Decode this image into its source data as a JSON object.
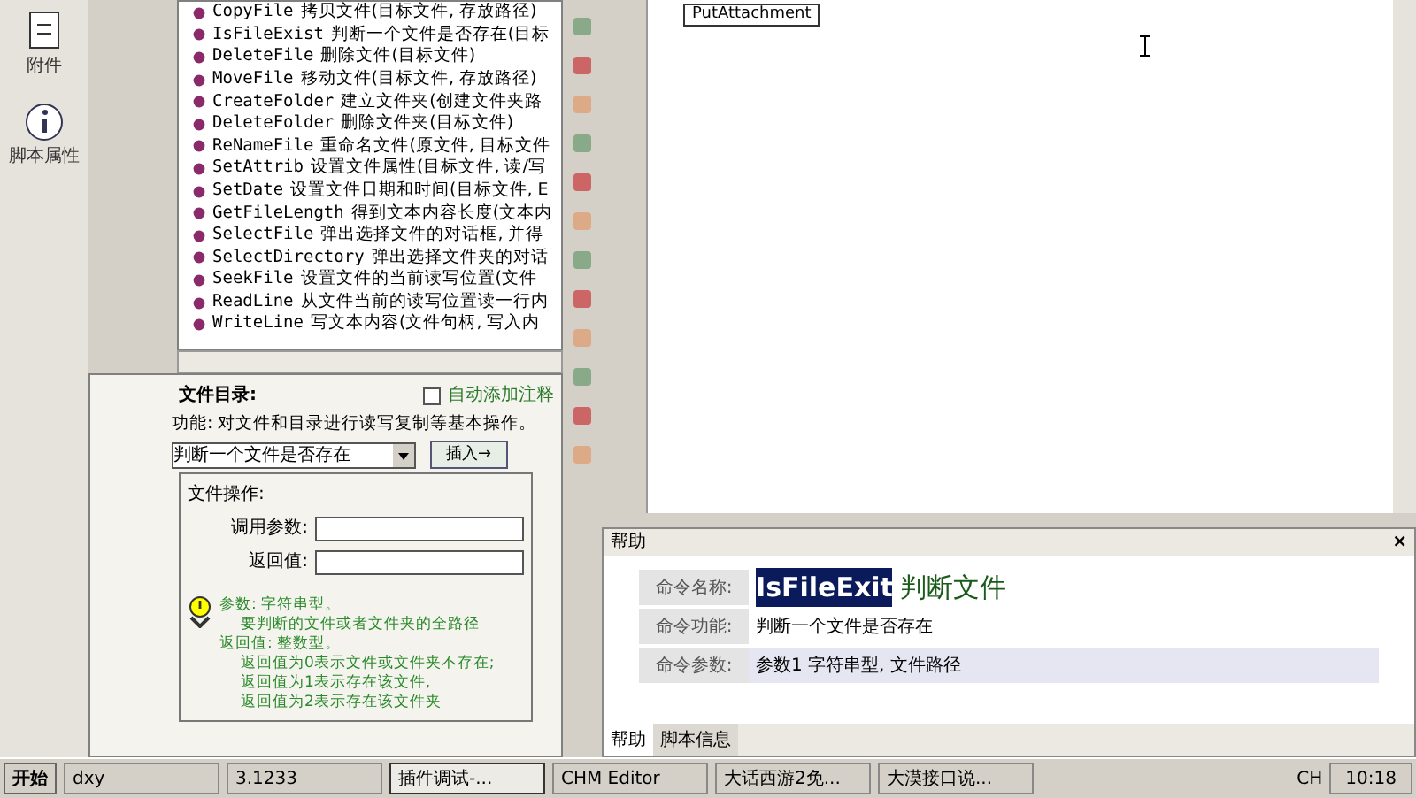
{
  "sidebar": {
    "items": [
      {
        "label": "附件",
        "kind": "attach"
      },
      {
        "label": "脚本属性",
        "kind": "info"
      }
    ]
  },
  "tree": {
    "items": [
      {
        "name": "CopyFile",
        "desc": "拷贝文件(目标文件, 存放路径)"
      },
      {
        "name": "IsFileExist",
        "desc": "判断一个文件是否存在(目标"
      },
      {
        "name": "DeleteFile",
        "desc": "删除文件(目标文件)"
      },
      {
        "name": "MoveFile",
        "desc": "移动文件(目标文件, 存放路径)"
      },
      {
        "name": "CreateFolder",
        "desc": "建立文件夹(创建文件夹路"
      },
      {
        "name": "DeleteFolder",
        "desc": "删除文件夹(目标文件)"
      },
      {
        "name": "ReNameFile",
        "desc": "重命名文件(原文件, 目标文件"
      },
      {
        "name": "SetAttrib",
        "desc": "设置文件属性(目标文件, 读/写"
      },
      {
        "name": "SetDate",
        "desc": "设置文件日期和时间(目标文件, E"
      },
      {
        "name": "GetFileLength",
        "desc": "得到文本内容长度(文本内"
      },
      {
        "name": "SelectFile",
        "desc": "弹出选择文件的对话框, 并得"
      },
      {
        "name": "SelectDirectory",
        "desc": "弹出选择文件夹的对话"
      },
      {
        "name": "SeekFile",
        "desc": "设置文件的当前读写位置(文件"
      },
      {
        "name": "ReadLine",
        "desc": "从文件当前的读写位置读一行内"
      },
      {
        "name": "WriteLine",
        "desc": "写文本内容(文件句柄, 写入内"
      }
    ]
  },
  "command_panel": {
    "category_label": "文件目录:",
    "auto_comment": {
      "label": "自动添加注释",
      "checked": false
    },
    "function_text": "功能: 对文件和目录进行读写复制等基本操作。",
    "command_select": "判断一个文件是否存在",
    "insert_button": "插入→",
    "group_title": "文件操作:",
    "fields": [
      {
        "label": "调用参数:"
      },
      {
        "label": "返回值:"
      }
    ],
    "hint_lines": [
      "参数: 字符串型。",
      "要判断的文件或者文件夹的全路径",
      "返回值: 整数型。",
      "返回值为0表示文件或文件夹不存在;",
      "返回值为1表示存在该文件,",
      "返回值为2表示存在该文件夹"
    ]
  },
  "editor": {
    "button": "PutAttachment"
  },
  "help": {
    "title": "帮助",
    "close": "×",
    "rows": [
      {
        "label": "命令名称:",
        "kind": "name",
        "code": "IsFileExit",
        "value": "判断文件"
      },
      {
        "label": "命令功能:",
        "kind": "text",
        "value": "判断一个文件是否存在"
      },
      {
        "label": "命令参数:",
        "kind": "text",
        "value": "参数1 字符串型, 文件路径"
      }
    ],
    "tabs": [
      {
        "label": "帮助",
        "selected": true
      },
      {
        "label": "脚本信息",
        "selected": false
      }
    ]
  },
  "taskbar": {
    "start": "开始",
    "items": [
      {
        "label": "dxy",
        "selected": false
      },
      {
        "label": "3.1233",
        "selected": false
      },
      {
        "label": "插件调试-...",
        "selected": true
      },
      {
        "label": "CHM Editor",
        "selected": false
      },
      {
        "label": "大话西游2免...",
        "selected": false
      },
      {
        "label": "大漠接口说...",
        "selected": false
      }
    ],
    "lang": "CH",
    "clock": "10:18"
  }
}
